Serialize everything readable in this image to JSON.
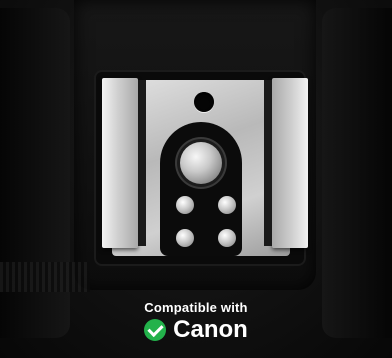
{
  "caption": {
    "line1": "Compatible with",
    "brand": "Canon"
  },
  "icons": {
    "check": "check-circle-icon",
    "check_color": "#23b24b"
  }
}
